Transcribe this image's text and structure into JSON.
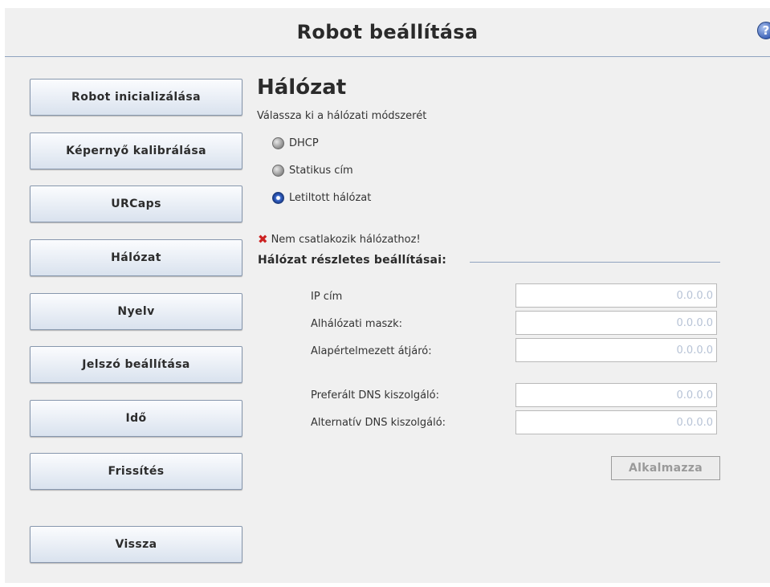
{
  "header": {
    "title": "Robot beállítása",
    "help_icon": "help-icon",
    "help_glyph": "?"
  },
  "sidebar": {
    "items": [
      {
        "label": "Robot inicializálása"
      },
      {
        "label": "Képernyő kalibrálása"
      },
      {
        "label": "URCaps"
      },
      {
        "label": "Hálózat"
      },
      {
        "label": "Nyelv"
      },
      {
        "label": "Jelszó beállítása"
      },
      {
        "label": "Idő"
      },
      {
        "label": "Frissítés"
      }
    ],
    "back_label": "Vissza"
  },
  "main": {
    "title": "Hálózat",
    "subtitle": "Válassza ki a hálózati módszerét",
    "methods": [
      {
        "label": "DHCP",
        "selected": false
      },
      {
        "label": "Statikus cím",
        "selected": false
      },
      {
        "label": "Letiltott hálózat",
        "selected": true
      }
    ],
    "status": {
      "icon": "error-x-icon",
      "glyph": "✖",
      "text": "Nem csatlakozik hálózathoz!"
    },
    "details_title": "Hálózat részletes beállításai:",
    "fields": [
      {
        "label": "IP cím",
        "placeholder": "0.0.0.0"
      },
      {
        "label": "Alhálózati maszk:",
        "placeholder": "0.0.0.0"
      },
      {
        "label": "Alapértelmezett átjáró:",
        "placeholder": "0.0.0.0"
      },
      {
        "label": "Preferált DNS kiszolgáló:",
        "placeholder": "0.0.0.0"
      },
      {
        "label": "Alternatív DNS kiszolgáló:",
        "placeholder": "0.0.0.0"
      }
    ],
    "apply_label": "Alkalmazza"
  },
  "colors": {
    "header_rule": "#8fa3bf",
    "background": "#f0f0f0",
    "selected_radio": "#3a6ad0",
    "error_icon": "#cc2222",
    "input_placeholder": "#b7c3d6"
  }
}
